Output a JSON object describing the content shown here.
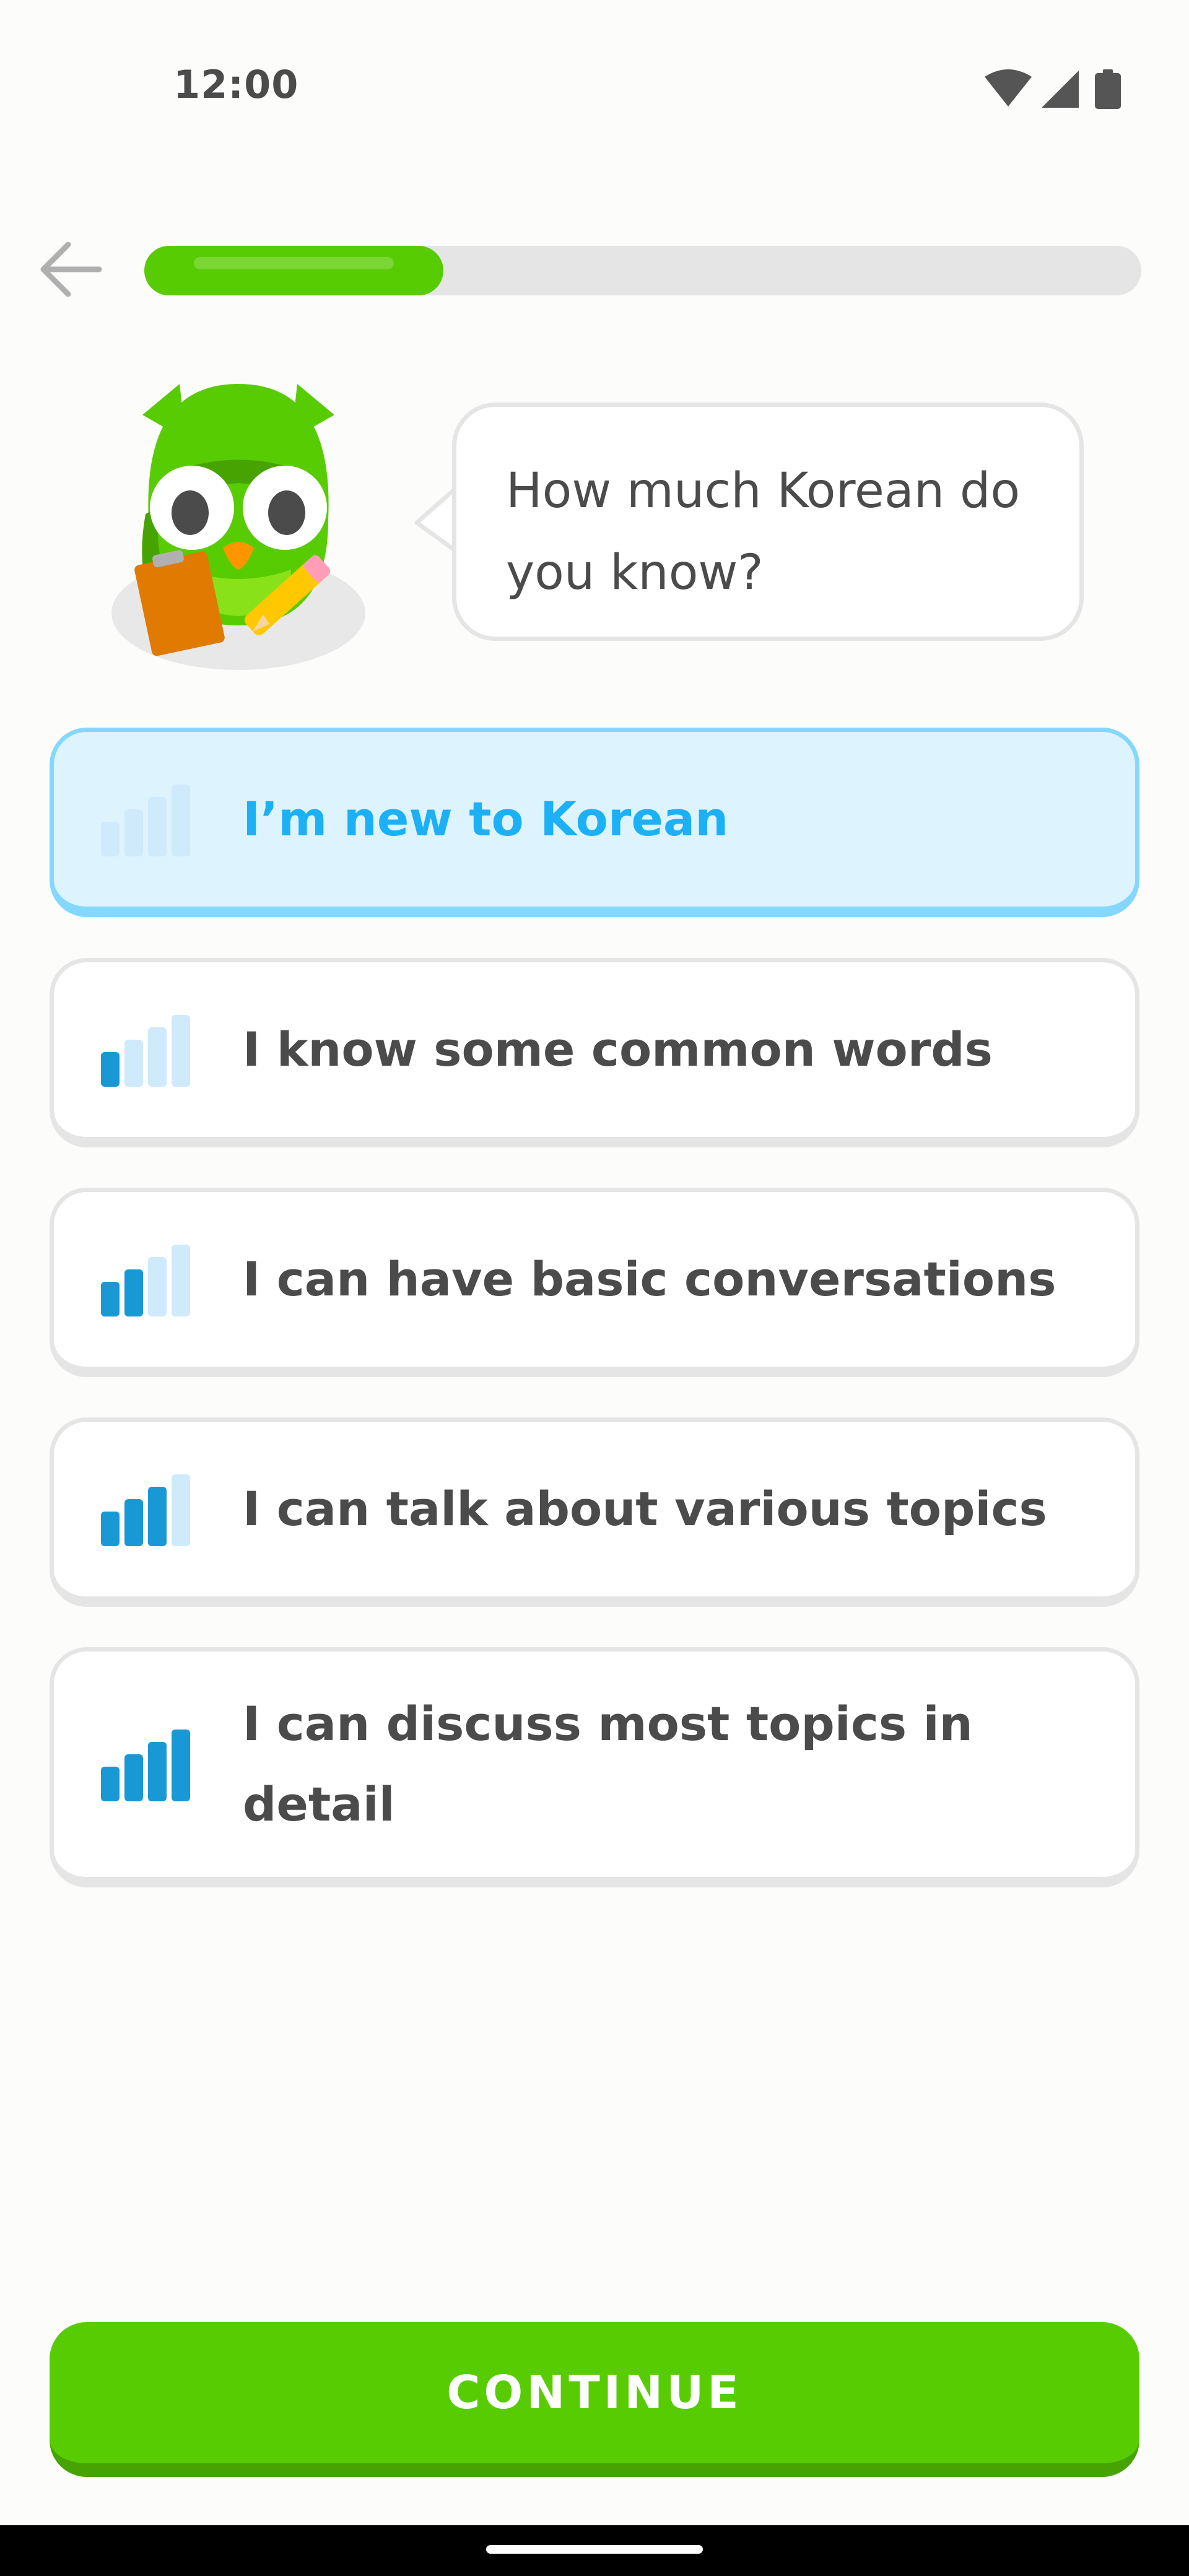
{
  "status_bar": {
    "time": "12:00",
    "icons": [
      "wifi-icon",
      "cell-signal-icon",
      "battery-icon"
    ]
  },
  "header": {
    "back_icon": "arrow-left-icon",
    "progress": 0.3
  },
  "question": {
    "text": "How much Korean do you know?"
  },
  "options": [
    {
      "label": "I’m new to Korean",
      "level": 0,
      "selected": true
    },
    {
      "label": "I know some common words",
      "level": 1,
      "selected": false
    },
    {
      "label": "I can have basic conversations",
      "level": 2,
      "selected": false
    },
    {
      "label": "I can talk about various topics",
      "level": 3,
      "selected": false
    },
    {
      "label": "I can discuss most topics in detail",
      "level": 4,
      "selected": false
    }
  ],
  "continue_button": {
    "label": "CONTINUE"
  },
  "colors": {
    "brand_green": "#58CC02",
    "green_shadow": "#46A302",
    "selected_blue": "#1CB0F6",
    "selected_border": "#84D8FF",
    "selected_bg": "#DDF4FF",
    "bar_active": "#1899D6",
    "bar_inactive": "#CFEAFB",
    "border_gray": "#E5E5E5",
    "text_dark": "#4B4B4B"
  }
}
